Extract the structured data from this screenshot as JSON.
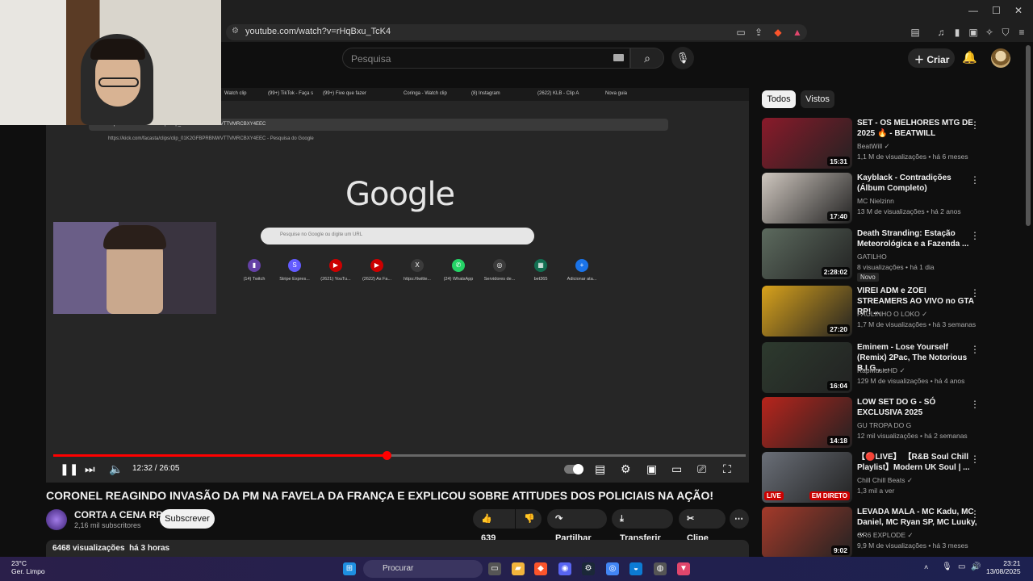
{
  "browser": {
    "url": "youtube.com/watch?v=rHqBxu_TcK4",
    "window_controls": [
      "—",
      "☐",
      "✕"
    ]
  },
  "youtube_header": {
    "search_placeholder": "Pesquisa",
    "create_label": "Criar"
  },
  "video": {
    "time": "12:32 / 26:05",
    "progress_fraction": 0.481,
    "title": "CORONEL REAGINDO INVASÃO DA PM NA FAVELA DA FRANÇA E EXPLICOU SOBRE ATITUDES DOS POLICIAIS NA AÇÃO!",
    "channel": "CORTA A CENA RP",
    "subscribers": "2,16 mil subscritores",
    "subscribe_label": "Subscrever",
    "likes": "639",
    "share_label": "Partilhar",
    "download_label": "Transferir",
    "clip_label": "Clipe",
    "views": "6468 visualizações",
    "age": "há 3 horas"
  },
  "inner_screen": {
    "tabs": [
      "Watch clip",
      "(99+) TikTok - Faça s",
      "(99+) Five que fazer",
      "Coringa - Watch clip",
      "(8) Instagram",
      "(2622) KLB - Clip A",
      "Nova guia"
    ],
    "omnibox_url": "https://kick.com/facasta/clips/clip_01K2GFBPRBNWVTTVMRCBXY4EEC",
    "omnibox_suggestion": "https://kick.com/facasta/clips/clip_01K2GFBPRBNWVTTVMRCBXY4EEC - Pesquisa do Google",
    "google_logo": "Google",
    "search_placeholder": "Pesquise no Google ou digite um URL",
    "shortcuts": [
      "(14) Twitch",
      "Stripe Expres...",
      "(2621) YouTu...",
      "(2622) As Fa...",
      "https://twitte...",
      "(24) WhatsApp",
      "Servidores de...",
      "bet365",
      "Adicionar ata..."
    ]
  },
  "filters": {
    "all": "Todos",
    "seen": "Vistos"
  },
  "recommendations": [
    {
      "title": "SET - OS MELHORES MTG DE 2025 🔥 - BEATWILL",
      "channel": "BeatWill",
      "verified": true,
      "meta": "1,1 M de visualizações • há 6 meses",
      "duration": "15:31",
      "color": "#8a1a2a"
    },
    {
      "title": "Kayblack - Contradições (Álbum Completo)",
      "channel": "MC Nielzinn",
      "verified": false,
      "meta": "13 M de visualizações • há 2 anos",
      "duration": "17:40",
      "color": "#cfc7bf"
    },
    {
      "title": "Death Stranding: Estação Meteorológica e a Fazenda ...",
      "channel": "GATILHO",
      "verified": false,
      "meta": "8 visualizações • há 1 dia",
      "duration": "2:28:02",
      "badge": "Novo",
      "color": "#5c6a5e"
    },
    {
      "title": "VIREI ADM e ZOEI STREAMERS AO VIVO no GTA RP! ...",
      "channel": "PAULINHO O LOKO",
      "verified": true,
      "meta": "1,7 M de visualizações • há 3 semanas",
      "duration": "27:20",
      "color": "#d8a21c"
    },
    {
      "title": "Eminem - Lose Yourself (Remix) 2Pac, The Notorious B.I.G., ...",
      "channel": "RapMusicHD",
      "verified": true,
      "meta": "129 M de visualizações • há 4 anos",
      "duration": "16:04",
      "color": "#2d3a2e"
    },
    {
      "title": "LOW SET DO G - SÓ EXCLUSIVA 2025",
      "channel": "GU TROPA DO G",
      "verified": false,
      "meta": "12 mil visualizações • há 2 semanas",
      "duration": "14:18",
      "color": "#b8241c"
    },
    {
      "title": "【🔴LIVE】 【R&B Soul Chill Playlist】Modern UK Soul | ...",
      "channel": "Chill Chill Beats",
      "verified": true,
      "meta": "1,3 mil a ver",
      "duration": "",
      "live_label": "EM DIRETO",
      "live_tag": "LIVE",
      "color": "#6a6f78"
    },
    {
      "title": "LEVADA MALA - MC Kadu, MC Daniel, MC Ryan SP, MC Luuky, ...",
      "channel": "GR6 EXPLODE",
      "verified": true,
      "meta": "9,9 M de visualizações • há 3 meses",
      "duration": "9:02",
      "color": "#a53a2a"
    }
  ],
  "taskbar": {
    "temperature": "23°C",
    "weather": "Ger. Limpo",
    "search_placeholder": "Procurar",
    "time": "23:21",
    "date": "13/08/2025"
  }
}
